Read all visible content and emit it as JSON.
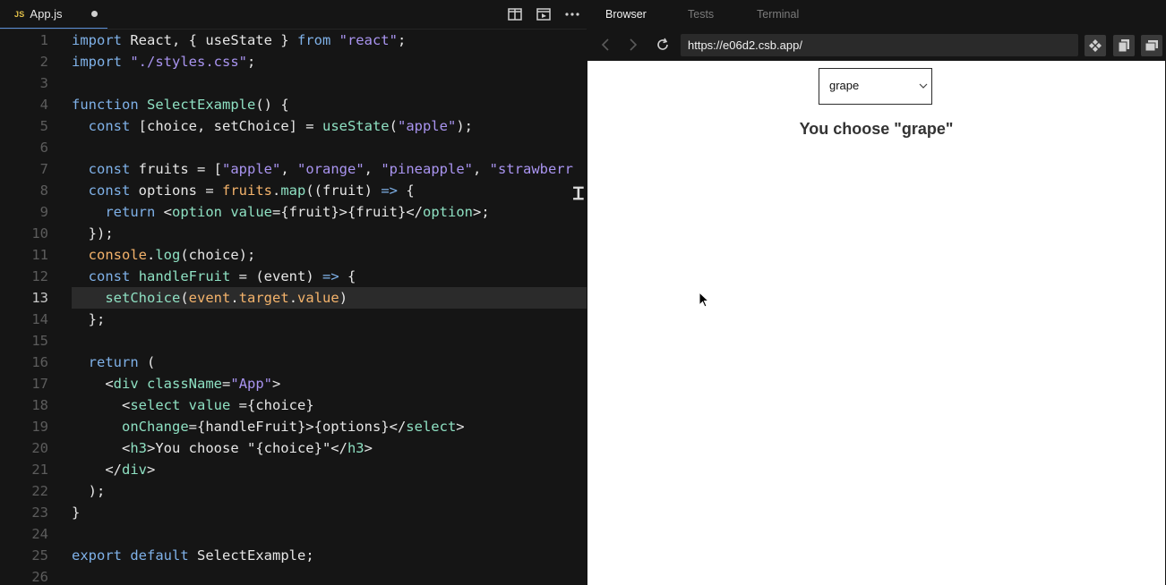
{
  "editor": {
    "tab": {
      "badge": "JS",
      "filename": "App.js"
    },
    "active_line": 13,
    "lines": [
      "<span class=\"kw\">import</span> React, { useState } <span class=\"kw\">from</span> <span class=\"str\">\"react\"</span>;",
      "<span class=\"kw\">import</span> <span class=\"str\">\"./styles.css\"</span>;",
      "",
      "<span class=\"kw\">function</span> <span class=\"fn\">SelectExample</span>() {",
      "  <span class=\"kw\">const</span> [choice, setChoice] = <span class=\"fn\">useState</span>(<span class=\"str\">\"apple\"</span>);",
      "",
      "  <span class=\"kw\">const</span> fruits = [<span class=\"str\">\"apple\"</span>, <span class=\"str\">\"orange\"</span>, <span class=\"str\">\"pineapple\"</span>, <span class=\"str\">\"strawberr</span>",
      "  <span class=\"kw\">const</span> options = <span class=\"prop\">fruits</span>.<span class=\"fn\">map</span>((fruit) <span class=\"op\">=></span> {",
      "    <span class=\"kw\">return</span> &lt;<span class=\"tag\">option</span> <span class=\"fn\">value</span>={fruit}&gt;{fruit}&lt;/<span class=\"tag\">option</span>&gt;;",
      "  });",
      "  <span class=\"prop\">console</span>.<span class=\"fn\">log</span>(choice);",
      "  <span class=\"kw\">const</span> <span class=\"fn\">handleFruit</span> = (event) <span class=\"op\">=></span> {",
      "    <span class=\"fn\">setChoice</span>(<span class=\"prop\">event</span>.<span class=\"prop\">target</span>.<span class=\"prop\">value</span>)",
      "  };",
      "",
      "  <span class=\"kw\">return</span> (",
      "    &lt;<span class=\"tag\">div</span> <span class=\"fn\">className</span>=<span class=\"str\">\"App\"</span>&gt;",
      "      &lt;<span class=\"tag\">select</span> <span class=\"fn\">value</span> ={choice}",
      "      <span class=\"fn\">onChange</span>={handleFruit}&gt;{options}&lt;/<span class=\"tag\">select</span>&gt;",
      "      &lt;<span class=\"tag\">h3</span>&gt;You choose \"{choice}\"&lt;/<span class=\"tag\">h3</span>&gt;",
      "    &lt;/<span class=\"tag\">div</span>&gt;",
      "  );",
      "}",
      "",
      "<span class=\"kw\">export</span> <span class=\"kw\">default</span> SelectExample;",
      ""
    ]
  },
  "preview": {
    "tabs": [
      "Browser",
      "Tests",
      "Terminal"
    ],
    "url": "https://e06d2.csb.app/",
    "select_value": "grape",
    "heading": "You choose \"grape\""
  }
}
